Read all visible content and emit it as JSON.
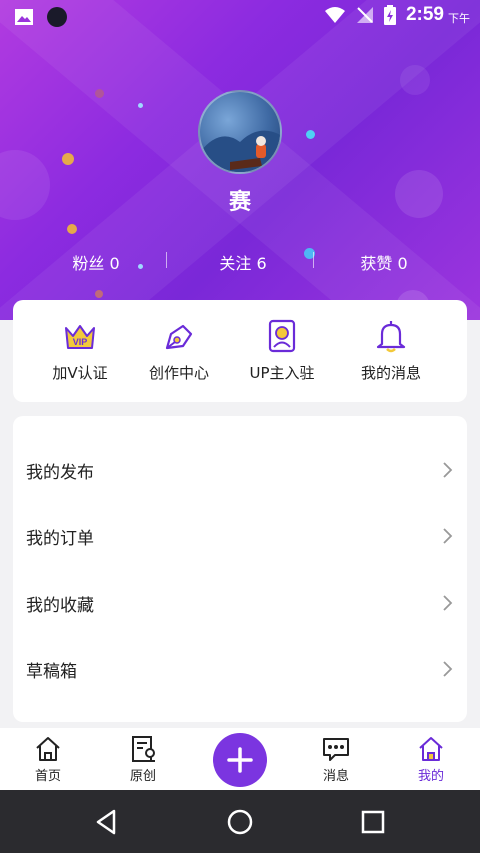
{
  "status_bar": {
    "time": "2:59",
    "ampm": "下午"
  },
  "profile": {
    "username": "赛",
    "stats": [
      {
        "label": "粉丝",
        "value": "0"
      },
      {
        "label": "关注",
        "value": "6"
      },
      {
        "label": "获赞",
        "value": "0"
      }
    ]
  },
  "quick_actions": [
    {
      "label": "加V认证",
      "icon": "vip-crown-icon"
    },
    {
      "label": "创作中心",
      "icon": "pen-nib-icon"
    },
    {
      "label": "UP主入驻",
      "icon": "id-card-icon"
    },
    {
      "label": "我的消息",
      "icon": "bell-icon"
    }
  ],
  "menu": [
    {
      "label": "我的发布"
    },
    {
      "label": "我的订单"
    },
    {
      "label": "我的收藏"
    },
    {
      "label": "草稿箱"
    }
  ],
  "tabs": [
    {
      "label": "首页",
      "icon": "home-icon"
    },
    {
      "label": "原创",
      "icon": "document-icon"
    },
    {
      "label": "",
      "icon": "plus-icon"
    },
    {
      "label": "消息",
      "icon": "chat-icon"
    },
    {
      "label": "我的",
      "icon": "home-active-icon",
      "active": true
    }
  ],
  "colors": {
    "accent": "#7b35e0",
    "hero_start": "#b23be0",
    "hero_end": "#7a28d8"
  }
}
